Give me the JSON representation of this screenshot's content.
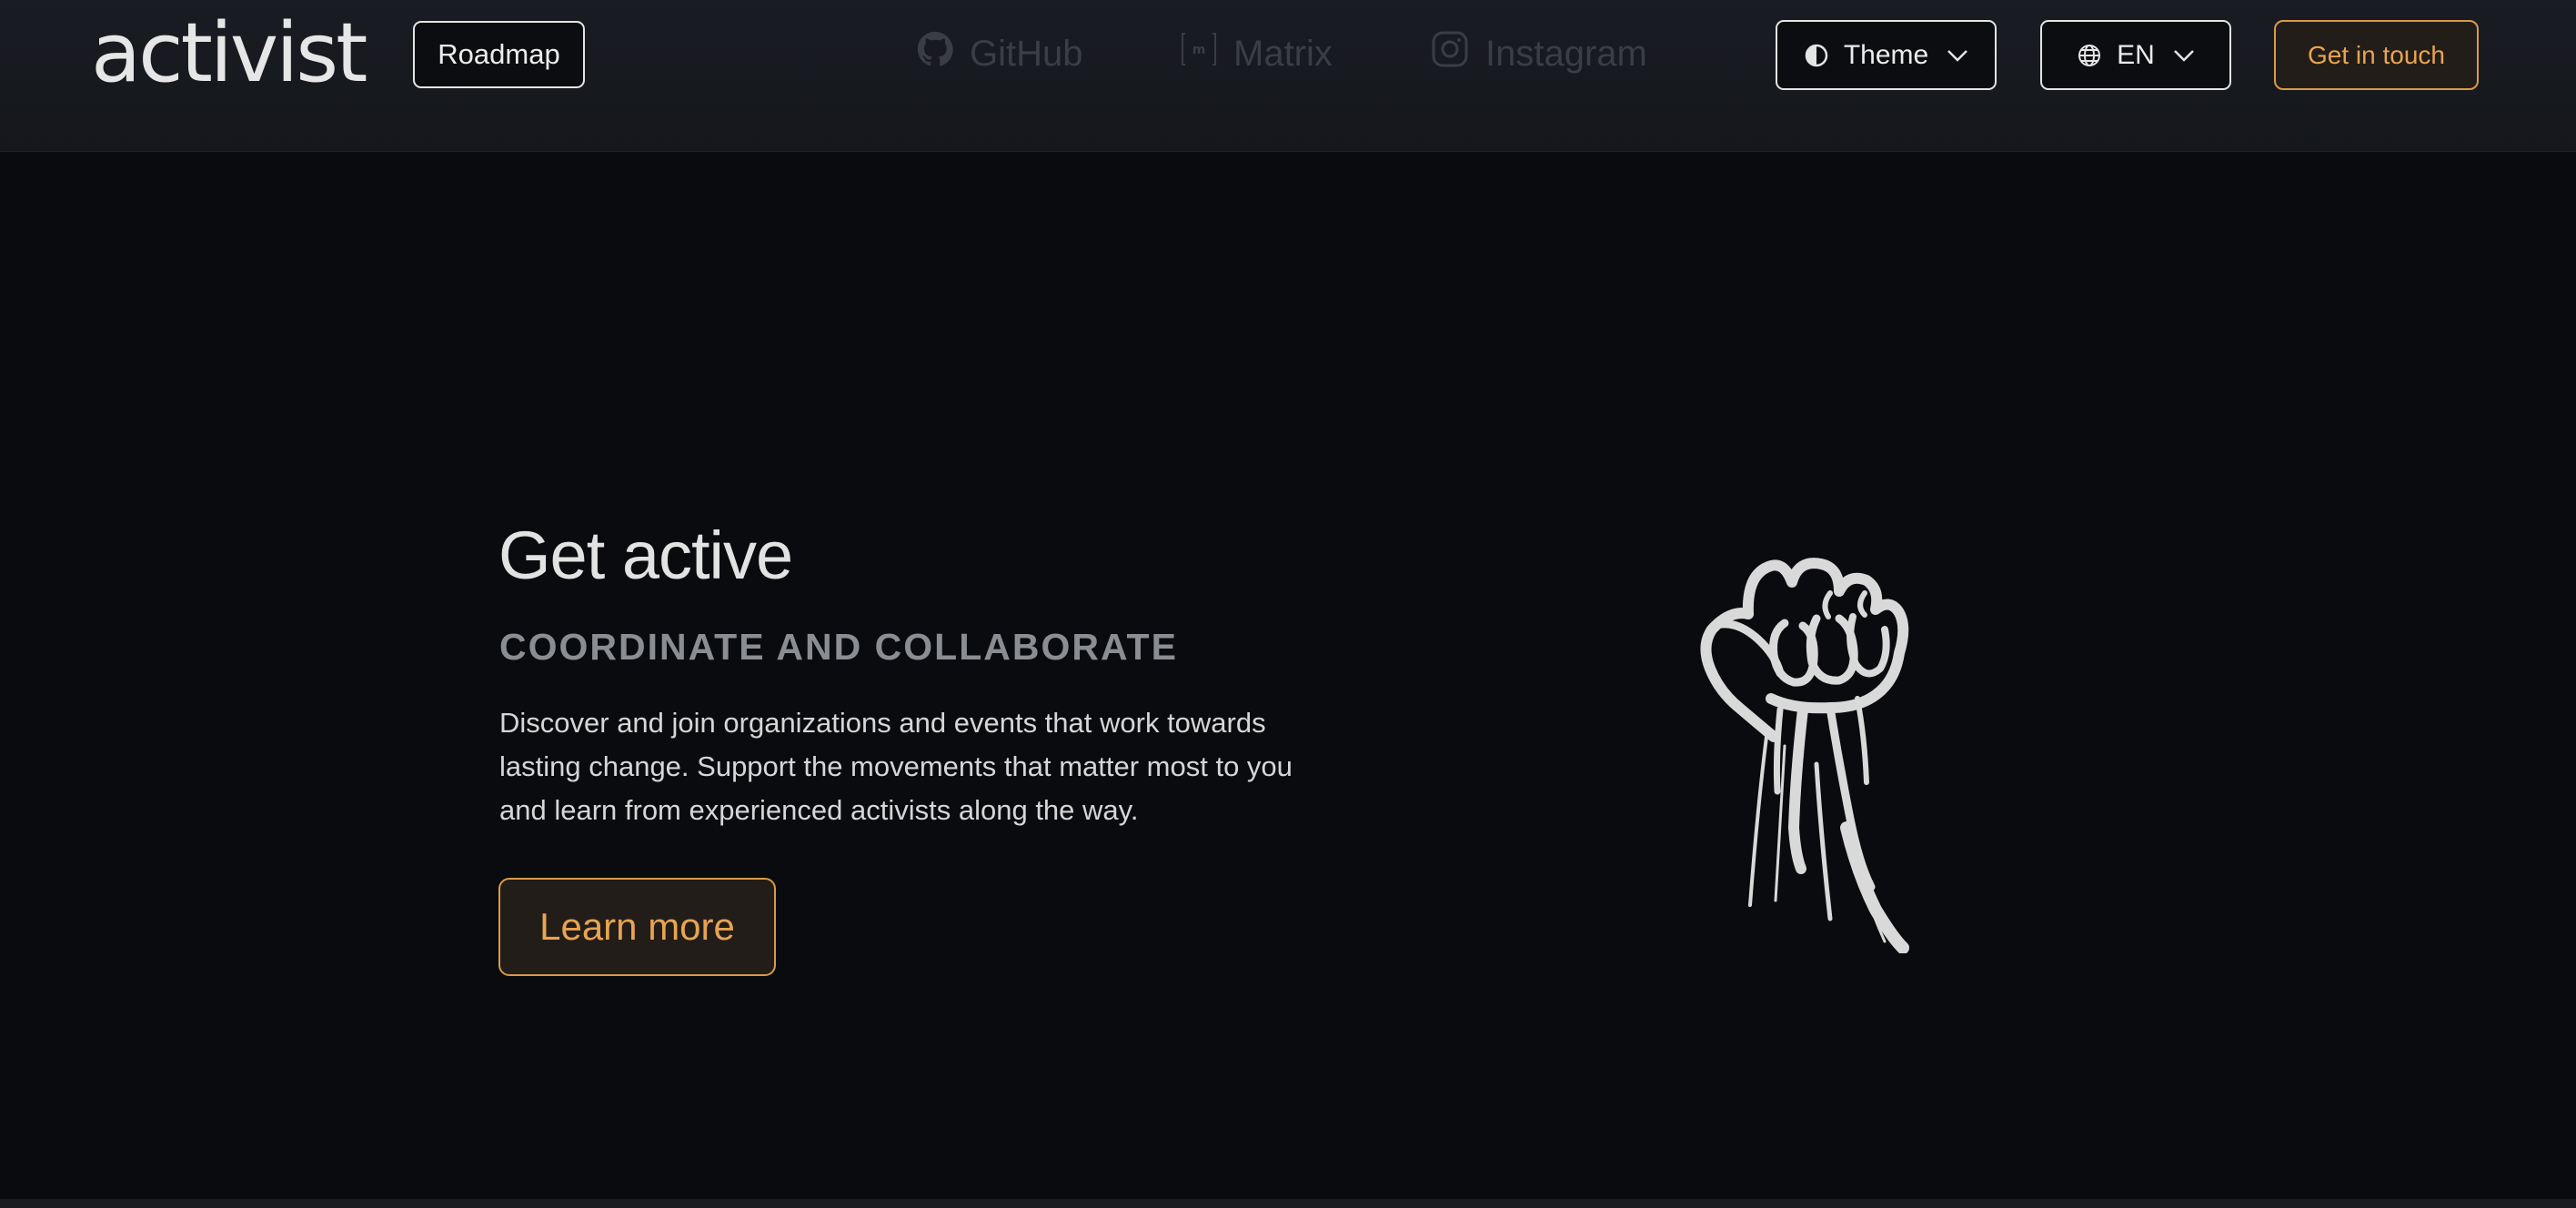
{
  "header": {
    "logo_text": "activist",
    "roadmap_label": "Roadmap",
    "social_links": [
      {
        "label": "GitHub",
        "icon": "github-icon"
      },
      {
        "label": "Matrix",
        "icon": "matrix-icon"
      },
      {
        "label": "Instagram",
        "icon": "instagram-icon"
      }
    ],
    "theme_label": "Theme",
    "language_label": "EN",
    "get_in_touch_label": "Get in touch"
  },
  "hero": {
    "title": "Get active",
    "subtitle": "COORDINATE AND COLLABORATE",
    "description": "Discover and join organizations and events that work towards lasting change. Support the movements that matter most to you and learn from experienced activists along the way.",
    "cta_label": "Learn more",
    "image": "raised-fist-icon"
  },
  "colors": {
    "background": "#0a0b0e",
    "header_background": "#191c22",
    "accent": "#e7a452",
    "accent_border": "#d99a4b",
    "text_primary": "#e2e2e2",
    "text_muted": "#8a8d92",
    "social_dim": "#3a3d44"
  }
}
